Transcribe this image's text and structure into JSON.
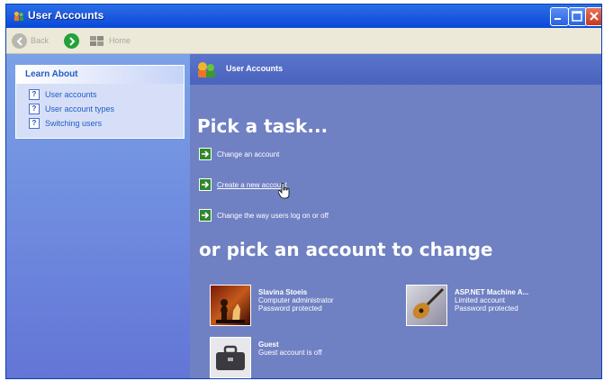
{
  "window": {
    "title": "User Accounts"
  },
  "toolbar": {
    "back_label": "Back",
    "home_label": "Home"
  },
  "learn_about": {
    "heading": "Learn About",
    "items": [
      {
        "label": "User accounts"
      },
      {
        "label": "User account types"
      },
      {
        "label": "Switching users"
      }
    ]
  },
  "main": {
    "header": "User Accounts",
    "pick_task": "Pick a task...",
    "tasks": [
      {
        "label": "Change an account"
      },
      {
        "label": "Create a new account"
      },
      {
        "label": "Change the way users log on or off"
      }
    ],
    "pick_account": "or pick an account to change",
    "accounts": [
      {
        "name": "Slavina Stoeis",
        "type": "Computer administrator",
        "status": "Password protected",
        "picture": "chess-pieces"
      },
      {
        "name": "ASP.NET Machine A...",
        "type": "Limited account",
        "status": "Password protected",
        "picture": "guitar"
      },
      {
        "name": "Guest",
        "type": "Guest account is off",
        "status": "",
        "picture": "briefcase"
      }
    ]
  },
  "colors": {
    "titlebar": "#0a49d8",
    "mainpane": "#6f80c3",
    "leftpane": "#6375d6",
    "toolbar": "#ece9d8"
  }
}
